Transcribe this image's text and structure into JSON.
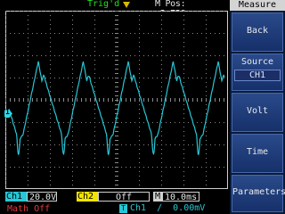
{
  "top": {
    "trigger_status": "Trig'd",
    "position": "M Pos: -2.720ms"
  },
  "menu": {
    "title": "Measure",
    "items": [
      {
        "label": "Back"
      },
      {
        "label": "Source",
        "value": "CH1"
      },
      {
        "label": "Volt"
      },
      {
        "label": "Time"
      },
      {
        "label": "Parameters"
      }
    ]
  },
  "channel_marker": "1",
  "status": {
    "ch1_label": "Ch1",
    "ch1_scale": "20.0V",
    "ch2_label": "Ch2",
    "ch2_state": "Off",
    "timebase_label": "M",
    "timebase": "10.0ms",
    "math": "Math Off",
    "trigger_badge": "T",
    "trigger_info": "Ch1  ∕  0.00mV"
  },
  "colors": {
    "ch1": "#27c7d6",
    "ch2": "#f2e400",
    "trig_status": "#1fe21f",
    "math": "#e23b3b"
  }
}
